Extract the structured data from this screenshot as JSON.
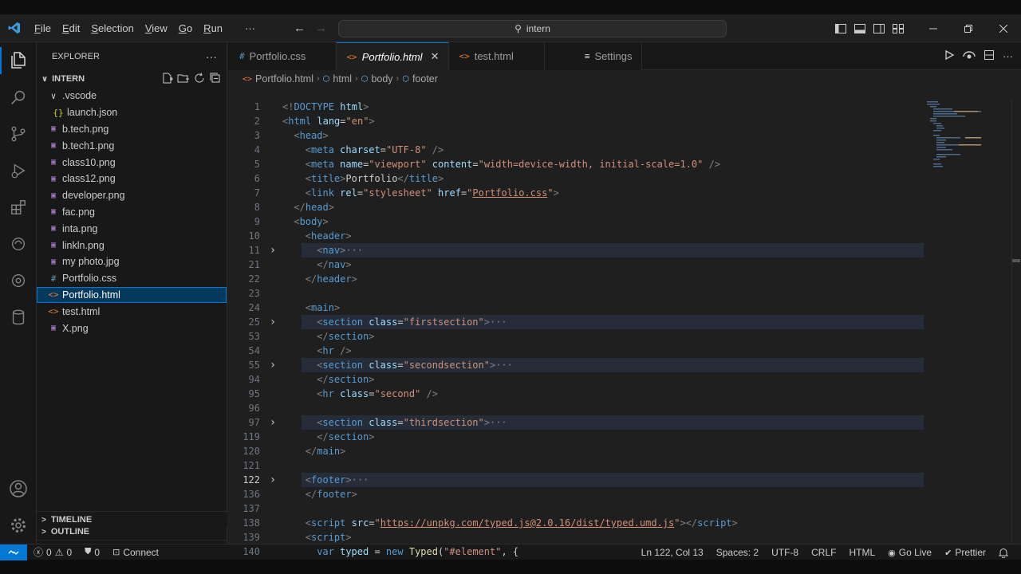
{
  "menu": {
    "items": [
      {
        "first": "F",
        "rest": "ile"
      },
      {
        "first": "E",
        "rest": "dit"
      },
      {
        "first": "S",
        "rest": "election"
      },
      {
        "first": "V",
        "rest": "iew"
      },
      {
        "first": "G",
        "rest": "o"
      },
      {
        "first": "R",
        "rest": "un"
      }
    ],
    "more": "···"
  },
  "command_center": {
    "text": "intern"
  },
  "explorer": {
    "title": "EXPLORER",
    "more": "···",
    "folder": "INTERN",
    "tree": [
      {
        "label": ".vscode",
        "icon": "chevron-down",
        "glyph": "∨",
        "color": "#cccccc",
        "indent": 1
      },
      {
        "label": "launch.json",
        "icon": "json-braces",
        "glyph": "{}",
        "color": "#cbcb41",
        "indent": 2
      },
      {
        "label": "b.tech.png",
        "icon": "image",
        "glyph": "▣",
        "color": "#a074c4",
        "indent": 1
      },
      {
        "label": "b.tech1.png",
        "icon": "image",
        "glyph": "▣",
        "color": "#a074c4",
        "indent": 1
      },
      {
        "label": "class10.png",
        "icon": "image",
        "glyph": "▣",
        "color": "#a074c4",
        "indent": 1
      },
      {
        "label": "class12.png",
        "icon": "image",
        "glyph": "▣",
        "color": "#a074c4",
        "indent": 1
      },
      {
        "label": "developer.png",
        "icon": "image",
        "glyph": "▣",
        "color": "#a074c4",
        "indent": 1
      },
      {
        "label": "fac.png",
        "icon": "image",
        "glyph": "▣",
        "color": "#a074c4",
        "indent": 1
      },
      {
        "label": "inta.png",
        "icon": "image",
        "glyph": "▣",
        "color": "#a074c4",
        "indent": 1
      },
      {
        "label": "linkln.png",
        "icon": "image",
        "glyph": "▣",
        "color": "#a074c4",
        "indent": 1
      },
      {
        "label": "my photo.jpg",
        "icon": "image",
        "glyph": "▣",
        "color": "#a074c4",
        "indent": 1
      },
      {
        "label": "Portfolio.css",
        "icon": "css-hash",
        "glyph": "#",
        "color": "#519aba",
        "indent": 1
      },
      {
        "label": "Portfolio.html",
        "icon": "html-brackets",
        "glyph": "<>",
        "color": "#e37933",
        "indent": 1,
        "selected": true
      },
      {
        "label": "test.html",
        "icon": "html-brackets",
        "glyph": "<>",
        "color": "#e37933",
        "indent": 1
      },
      {
        "label": "X.png",
        "icon": "image",
        "glyph": "▣",
        "color": "#a074c4",
        "indent": 1
      }
    ],
    "outline": "OUTLINE",
    "timeline": "TIMELINE"
  },
  "tabs": [
    {
      "label": "Portfolio.css",
      "icon": "css-hash",
      "glyph": "#",
      "color": "#519aba"
    },
    {
      "label": "Portfolio.html",
      "icon": "html-brackets",
      "glyph": "<>",
      "color": "#e37933",
      "active": true
    },
    {
      "label": "test.html",
      "icon": "html-brackets",
      "glyph": "<>",
      "color": "#e37933"
    },
    {
      "label": "Settings",
      "icon": "settings-lines",
      "glyph": "≡",
      "color": "#cccccc"
    }
  ],
  "breadcrumb": [
    "Portfolio.html",
    "html",
    "body",
    "footer"
  ],
  "code": [
    {
      "n": "1",
      "tokens": [
        [
          "p",
          "<!"
        ],
        [
          "tag",
          "DOCTYPE"
        ],
        [
          "t",
          " "
        ],
        [
          "at",
          "html"
        ],
        [
          "p",
          ">"
        ]
      ]
    },
    {
      "n": "2",
      "tokens": [
        [
          "p",
          "<"
        ],
        [
          "tag",
          "html"
        ],
        [
          "t",
          " "
        ],
        [
          "at",
          "lang"
        ],
        [
          "t",
          "="
        ],
        [
          "str",
          "\"en\""
        ],
        [
          "p",
          ">"
        ]
      ]
    },
    {
      "n": "3",
      "indent": 1,
      "tokens": [
        [
          "p",
          "<"
        ],
        [
          "tag",
          "head"
        ],
        [
          "p",
          ">"
        ]
      ]
    },
    {
      "n": "4",
      "indent": 2,
      "tokens": [
        [
          "p",
          "<"
        ],
        [
          "tag",
          "meta"
        ],
        [
          "t",
          " "
        ],
        [
          "at",
          "charset"
        ],
        [
          "t",
          "="
        ],
        [
          "str",
          "\"UTF-8\""
        ],
        [
          "t",
          " "
        ],
        [
          "p",
          "/>"
        ]
      ]
    },
    {
      "n": "5",
      "indent": 2,
      "tokens": [
        [
          "p",
          "<"
        ],
        [
          "tag",
          "meta"
        ],
        [
          "t",
          " "
        ],
        [
          "at",
          "name"
        ],
        [
          "t",
          "="
        ],
        [
          "str",
          "\"viewport\""
        ],
        [
          "t",
          " "
        ],
        [
          "at",
          "content"
        ],
        [
          "t",
          "="
        ],
        [
          "str",
          "\"width=device-width, initial-scale=1.0\""
        ],
        [
          "t",
          " "
        ],
        [
          "p",
          "/>"
        ]
      ]
    },
    {
      "n": "6",
      "indent": 2,
      "tokens": [
        [
          "p",
          "<"
        ],
        [
          "tag",
          "title"
        ],
        [
          "p",
          ">"
        ],
        [
          "t",
          "Portfolio"
        ],
        [
          "p",
          "</"
        ],
        [
          "tag",
          "title"
        ],
        [
          "p",
          ">"
        ]
      ]
    },
    {
      "n": "7",
      "indent": 2,
      "tokens": [
        [
          "p",
          "<"
        ],
        [
          "tag",
          "link"
        ],
        [
          "t",
          " "
        ],
        [
          "at",
          "rel"
        ],
        [
          "t",
          "="
        ],
        [
          "str",
          "\"stylesheet\""
        ],
        [
          "t",
          " "
        ],
        [
          "at",
          "href"
        ],
        [
          "t",
          "="
        ],
        [
          "str",
          "\""
        ],
        [
          "stru",
          "Portfolio.css"
        ],
        [
          "str",
          "\""
        ],
        [
          "p",
          ">"
        ]
      ]
    },
    {
      "n": "8",
      "indent": 1,
      "tokens": [
        [
          "p",
          "</"
        ],
        [
          "tag",
          "head"
        ],
        [
          "p",
          ">"
        ]
      ]
    },
    {
      "n": "9",
      "indent": 1,
      "tokens": [
        [
          "p",
          "<"
        ],
        [
          "tag",
          "body"
        ],
        [
          "p",
          ">"
        ]
      ]
    },
    {
      "n": "10",
      "indent": 2,
      "tokens": [
        [
          "p",
          "<"
        ],
        [
          "tag",
          "header"
        ],
        [
          "p",
          ">"
        ]
      ]
    },
    {
      "n": "11",
      "indent": 3,
      "fold": true,
      "tokens": [
        [
          "p",
          "<"
        ],
        [
          "tag",
          "nav"
        ],
        [
          "p",
          ">"
        ],
        [
          "dots",
          "···"
        ]
      ]
    },
    {
      "n": "21",
      "indent": 3,
      "tokens": [
        [
          "p",
          "</"
        ],
        [
          "tag",
          "nav"
        ],
        [
          "p",
          ">"
        ]
      ]
    },
    {
      "n": "22",
      "indent": 2,
      "tokens": [
        [
          "p",
          "</"
        ],
        [
          "tag",
          "header"
        ],
        [
          "p",
          ">"
        ]
      ]
    },
    {
      "n": "23",
      "tokens": []
    },
    {
      "n": "24",
      "indent": 2,
      "tokens": [
        [
          "p",
          "<"
        ],
        [
          "tag",
          "main"
        ],
        [
          "p",
          ">"
        ]
      ]
    },
    {
      "n": "25",
      "indent": 3,
      "fold": true,
      "tokens": [
        [
          "p",
          "<"
        ],
        [
          "tag",
          "section"
        ],
        [
          "t",
          " "
        ],
        [
          "at",
          "class"
        ],
        [
          "t",
          "="
        ],
        [
          "str",
          "\"firstsection\""
        ],
        [
          "p",
          ">"
        ],
        [
          "dots",
          "···"
        ]
      ]
    },
    {
      "n": "53",
      "indent": 3,
      "tokens": [
        [
          "p",
          "</"
        ],
        [
          "tag",
          "section"
        ],
        [
          "p",
          ">"
        ]
      ]
    },
    {
      "n": "54",
      "indent": 3,
      "tokens": [
        [
          "p",
          "<"
        ],
        [
          "tag",
          "hr"
        ],
        [
          "t",
          " "
        ],
        [
          "p",
          "/>"
        ]
      ]
    },
    {
      "n": "55",
      "indent": 3,
      "fold": true,
      "tokens": [
        [
          "p",
          "<"
        ],
        [
          "tag",
          "section"
        ],
        [
          "t",
          " "
        ],
        [
          "at",
          "class"
        ],
        [
          "t",
          "="
        ],
        [
          "str",
          "\"secondsection\""
        ],
        [
          "p",
          ">"
        ],
        [
          "dots",
          "···"
        ]
      ]
    },
    {
      "n": "94",
      "indent": 3,
      "tokens": [
        [
          "p",
          "</"
        ],
        [
          "tag",
          "section"
        ],
        [
          "p",
          ">"
        ]
      ]
    },
    {
      "n": "95",
      "indent": 3,
      "tokens": [
        [
          "p",
          "<"
        ],
        [
          "tag",
          "hr"
        ],
        [
          "t",
          " "
        ],
        [
          "at",
          "class"
        ],
        [
          "t",
          "="
        ],
        [
          "str",
          "\"second\""
        ],
        [
          "t",
          " "
        ],
        [
          "p",
          "/>"
        ]
      ]
    },
    {
      "n": "96",
      "tokens": []
    },
    {
      "n": "97",
      "indent": 3,
      "fold": true,
      "tokens": [
        [
          "p",
          "<"
        ],
        [
          "tag",
          "section"
        ],
        [
          "t",
          " "
        ],
        [
          "at",
          "class"
        ],
        [
          "t",
          "="
        ],
        [
          "str",
          "\"thirdsection\""
        ],
        [
          "p",
          ">"
        ],
        [
          "dots",
          "···"
        ]
      ]
    },
    {
      "n": "119",
      "indent": 3,
      "tokens": [
        [
          "p",
          "</"
        ],
        [
          "tag",
          "section"
        ],
        [
          "p",
          ">"
        ]
      ]
    },
    {
      "n": "120",
      "indent": 2,
      "tokens": [
        [
          "p",
          "</"
        ],
        [
          "tag",
          "main"
        ],
        [
          "p",
          ">"
        ]
      ]
    },
    {
      "n": "121",
      "tokens": []
    },
    {
      "n": "122",
      "indent": 2,
      "fold": true,
      "current": true,
      "tokens": [
        [
          "p",
          "<"
        ],
        [
          "tag",
          "footer"
        ],
        [
          "p",
          ">"
        ],
        [
          "dots",
          "···"
        ]
      ]
    },
    {
      "n": "136",
      "indent": 2,
      "tokens": [
        [
          "p",
          "</"
        ],
        [
          "tag",
          "footer"
        ],
        [
          "p",
          ">"
        ]
      ]
    },
    {
      "n": "137",
      "tokens": []
    },
    {
      "n": "138",
      "indent": 2,
      "tokens": [
        [
          "p",
          "<"
        ],
        [
          "tag",
          "script"
        ],
        [
          "t",
          " "
        ],
        [
          "at",
          "src"
        ],
        [
          "t",
          "="
        ],
        [
          "str",
          "\""
        ],
        [
          "stru",
          "https://unpkg.com/typed.js@2.0.16/dist/typed.umd.js"
        ],
        [
          "str",
          "\""
        ],
        [
          "p",
          "></"
        ],
        [
          "tag",
          "script"
        ],
        [
          "p",
          ">"
        ]
      ]
    },
    {
      "n": "139",
      "indent": 2,
      "tokens": [
        [
          "p",
          "<"
        ],
        [
          "tag",
          "script"
        ],
        [
          "p",
          ">"
        ]
      ]
    },
    {
      "n": "140",
      "indent": 3,
      "tokens": [
        [
          "kw",
          "var"
        ],
        [
          "t",
          " "
        ],
        [
          "var",
          "typed"
        ],
        [
          "t",
          " = "
        ],
        [
          "kw",
          "new"
        ],
        [
          "t",
          " "
        ],
        [
          "fn",
          "Typed"
        ],
        [
          "t",
          "("
        ],
        [
          "str",
          "\"#element\""
        ],
        [
          "t",
          ", {"
        ]
      ]
    }
  ],
  "status": {
    "errors": "0",
    "warnings": "0",
    "ports": "0",
    "connect": "Connect",
    "position": "Ln 122, Col 13",
    "spaces": "Spaces: 2",
    "encoding": "UTF-8",
    "eol": "CRLF",
    "language": "HTML",
    "golive": "Go Live",
    "prettier": "Prettier"
  },
  "colors": {
    "accent": "#0078d4",
    "selection": "#04395e",
    "tag": "#569cd6",
    "attr": "#9cdcfe",
    "string": "#ce9178"
  }
}
